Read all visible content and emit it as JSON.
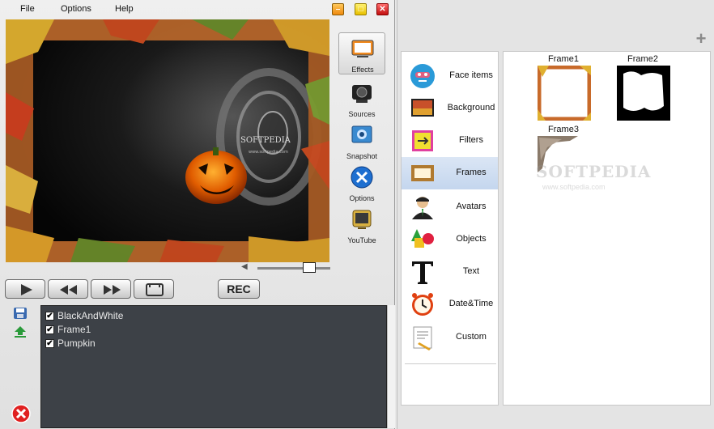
{
  "menu": {
    "file": "File",
    "options": "Options",
    "help": "Help"
  },
  "window_controls": {
    "minimize": "–",
    "maximize": "□",
    "close": "✕"
  },
  "preview": {
    "logo_text": "SOFTPEDIA",
    "logo_url": "www.softpedia.com"
  },
  "side_tools": [
    {
      "label": "Effects",
      "icon": "effects-icon",
      "active": true
    },
    {
      "label": "Sources",
      "icon": "camera-icon"
    },
    {
      "label": "Snapshot",
      "icon": "snapshot-icon"
    },
    {
      "label": "Options",
      "icon": "options-tools-icon"
    },
    {
      "label": "YouTube",
      "icon": "youtube-tv-icon"
    }
  ],
  "transport": {
    "rec_label": "REC"
  },
  "layers": [
    {
      "label": "BlackAndWhite",
      "checked": true
    },
    {
      "label": "Frame1",
      "checked": true
    },
    {
      "label": "Pumpkin",
      "checked": true
    }
  ],
  "categories": [
    {
      "label": "Face items",
      "icon": "mask-icon"
    },
    {
      "label": "Background",
      "icon": "background-icon"
    },
    {
      "label": "Filters",
      "icon": "filters-icon"
    },
    {
      "label": "Frames",
      "icon": "frame-icon",
      "selected": true
    },
    {
      "label": "Avatars",
      "icon": "avatar-icon"
    },
    {
      "label": "Objects",
      "icon": "shapes-icon"
    },
    {
      "label": "Text",
      "icon": "text-t-icon"
    },
    {
      "label": "Date&Time",
      "icon": "alarm-clock-icon"
    },
    {
      "label": "Custom",
      "icon": "custom-document-icon"
    }
  ],
  "frames": [
    {
      "label": "Frame1"
    },
    {
      "label": "Frame2"
    },
    {
      "label": "Frame3"
    }
  ],
  "watermark": {
    "text": "SOFTPEDIA",
    "url": "www.softpedia.com"
  },
  "colors": {
    "accent_selected": "#c4d6ee",
    "layers_bg": "#3d4147"
  }
}
